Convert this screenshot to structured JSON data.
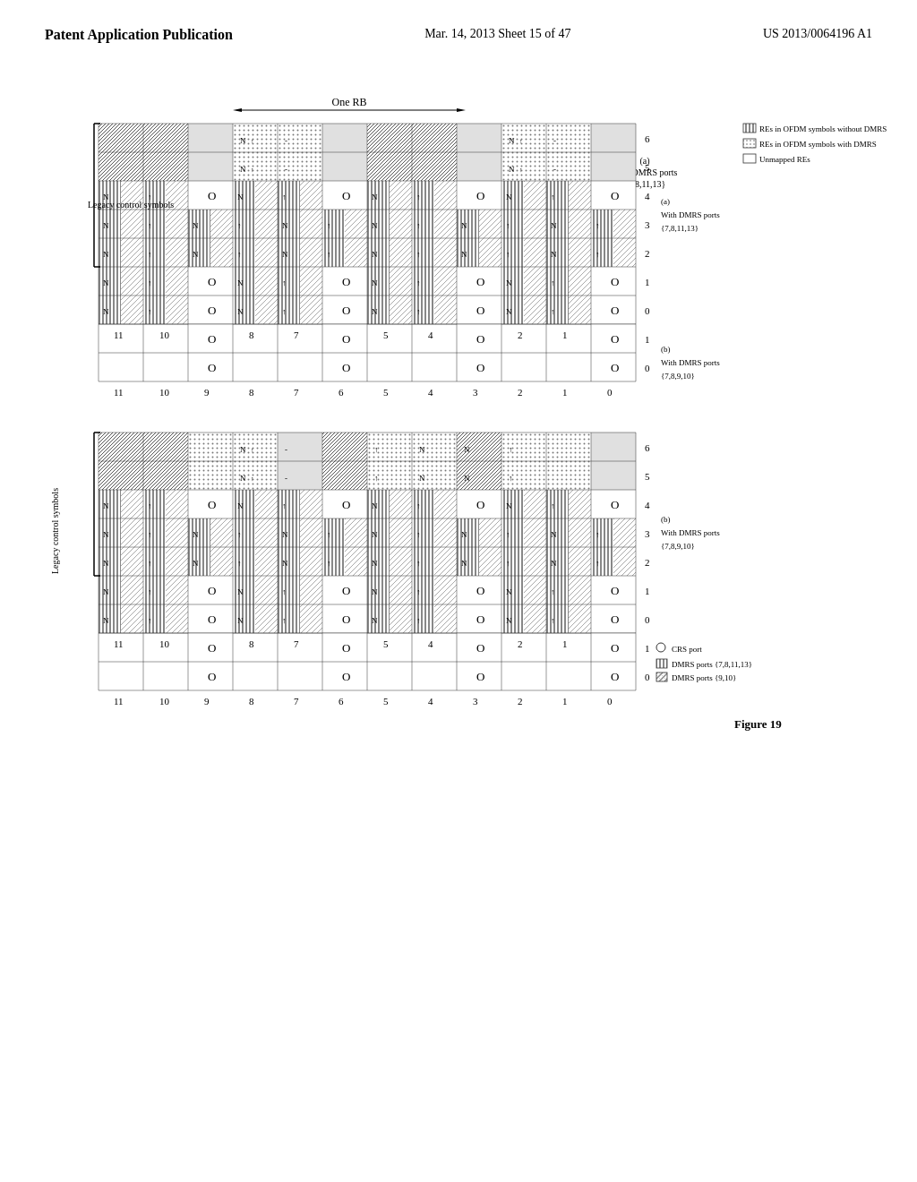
{
  "header": {
    "left": "Patent Application Publication",
    "center": "Mar. 14, 2013  Sheet 15 of 47",
    "right": "US 2013/0064196 A1"
  },
  "figure": {
    "number": "Figure 19",
    "one_rb_label": "One RB",
    "x_labels": [
      "0",
      "1",
      "2",
      "3",
      "4",
      "5",
      "6",
      "7",
      "8",
      "9",
      "10",
      "11"
    ],
    "y_labels": [
      "0",
      "1",
      "2",
      "3",
      "4",
      "5",
      "6"
    ],
    "legacy_label": "Legacy control symbols",
    "diagram_a_title": "(a)",
    "diagram_a_subtitle": "With DMRS ports",
    "diagram_a_ports": "{7,8,11,13}",
    "diagram_b_title": "(b)",
    "diagram_b_subtitle": "With DMRS ports",
    "diagram_b_ports": "{7,8,9,10}",
    "legend": {
      "items": [
        {
          "label": "CRS port",
          "type": "empty"
        },
        {
          "label": "DMRS ports {7,8,11,13}",
          "type": "hatched"
        },
        {
          "label": "DMRS ports {9,10}",
          "type": "dotted"
        }
      ]
    },
    "right_legend": {
      "items": [
        {
          "label": "REs in OFDM symbols without DMRS",
          "type": "striped"
        },
        {
          "label": "REs in OFDM symbols with DMRS",
          "type": "dotted"
        },
        {
          "label": "Unmapped REs",
          "type": "empty"
        }
      ]
    }
  }
}
